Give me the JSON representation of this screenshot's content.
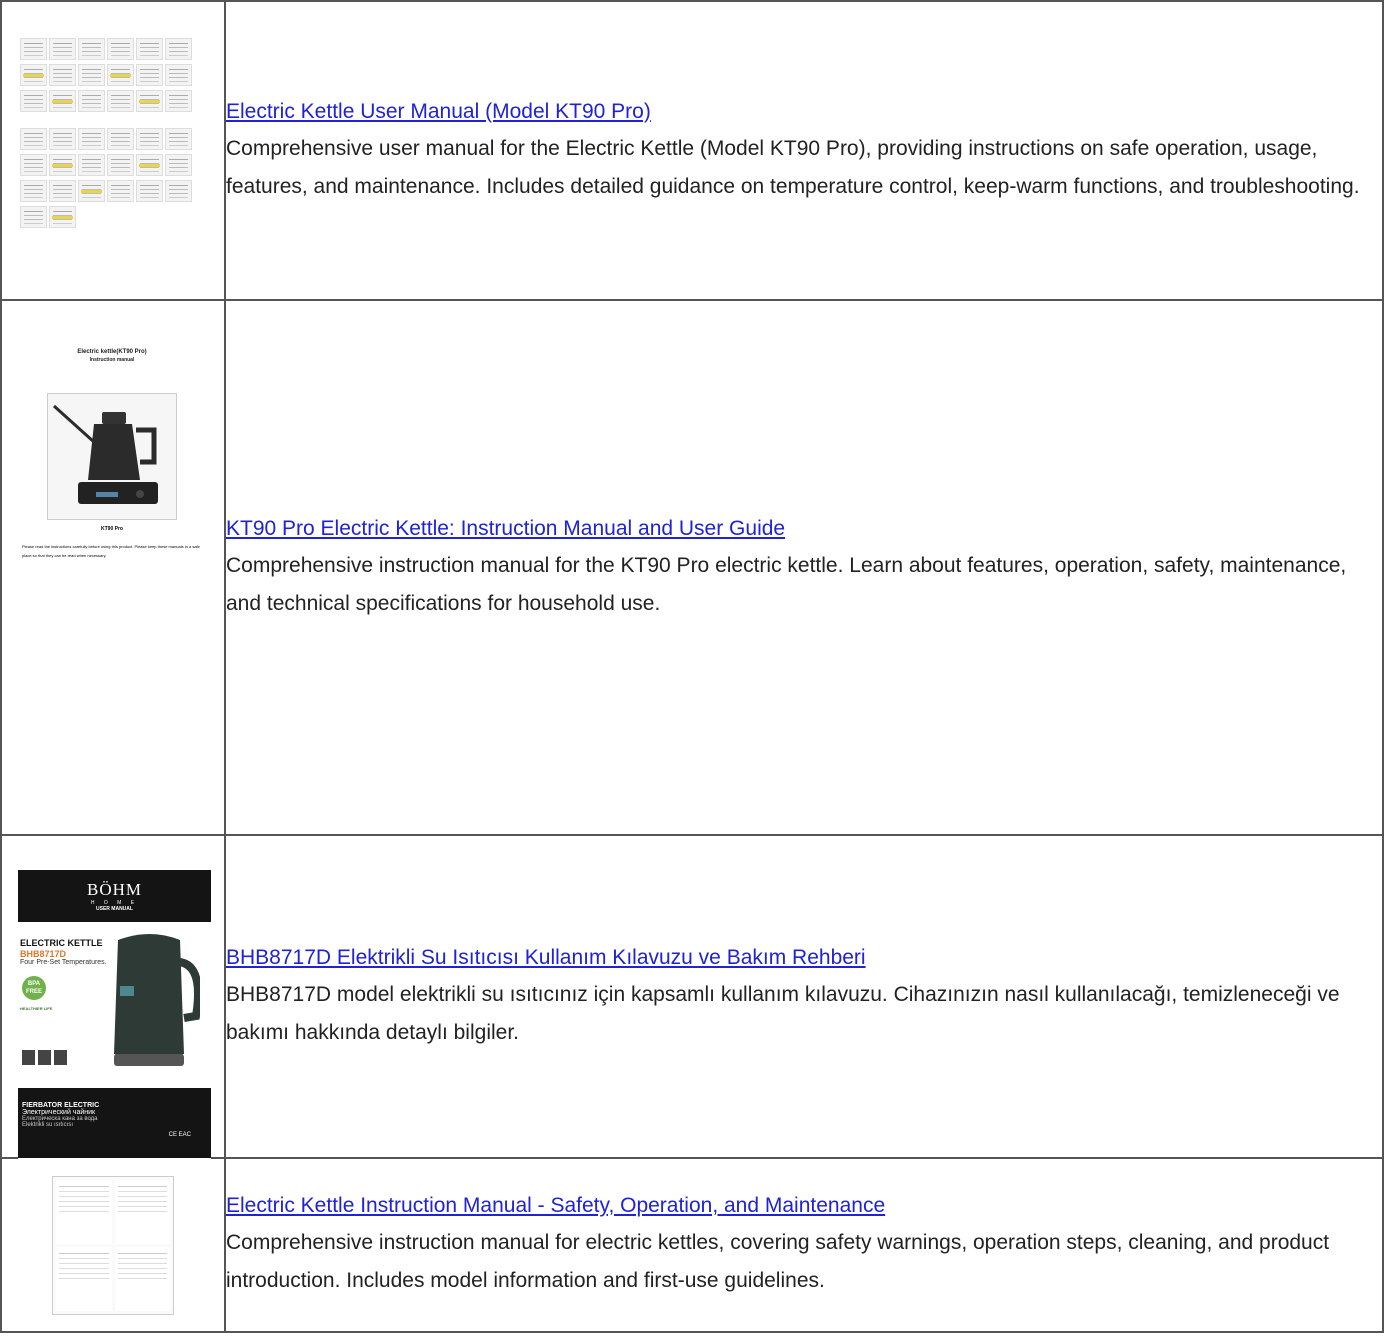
{
  "rows": [
    {
      "title": "Electric Kettle User Manual (Model KT90 Pro)",
      "description": "Comprehensive user manual for the Electric Kettle (Model KT90 Pro), providing instructions on safe operation, usage, features, and maintenance. Includes detailed guidance on temperature control, keep-warm functions, and troubleshooting."
    },
    {
      "title": "KT90 Pro Electric Kettle: Instruction Manual and User Guide",
      "description": "Comprehensive instruction manual for the KT90 Pro electric kettle. Learn about features, operation, safety, maintenance, and technical specifications for household use.",
      "thumb": {
        "line1": "Electric kettle(KT90 Pro)",
        "line2": "Instruction manual",
        "caption": "KT90 Pro",
        "note": "Please read the instructions carefully before using this product. Please keep these manuals in a safe place so that they can be read when necessary."
      }
    },
    {
      "title": "BHB8717D Elektrikli Su Isıtıcısı Kullanım Kılavuzu ve Bakım Rehberi",
      "description": "BHB8717D model elektrikli su ısıtıcınız için kapsamlı kullanım kılavuzu. Cihazınızın nasıl kullanılacağı, temizleneceği ve bakımı hakkında detaylı bilgiler.",
      "thumb": {
        "brand": "BÖHM",
        "brand_sub": "H O M E",
        "brand_sub2": "USER MANUAL",
        "product": "ELECTRIC KETTLE",
        "model": "BHB8717D",
        "tagline": "Four Pre-Set Temperatures.",
        "bpa": "BPA FREE",
        "healthy": "HEALTHIER LIFE",
        "bottom1": "FIERBATOR ELECTRIC",
        "bottom2": "Электрический чайник",
        "bottom3": "Електрическа кана за вода",
        "bottom4": "Elektrikli su ısıtıcısı",
        "marks": "CE EAC"
      }
    },
    {
      "title": "Electric Kettle Instruction Manual - Safety, Operation, and Maintenance",
      "description": "Comprehensive instruction manual for electric kettles, covering safety warnings, operation steps, cleaning, and product introduction. Includes model information and first-use guidelines."
    }
  ]
}
